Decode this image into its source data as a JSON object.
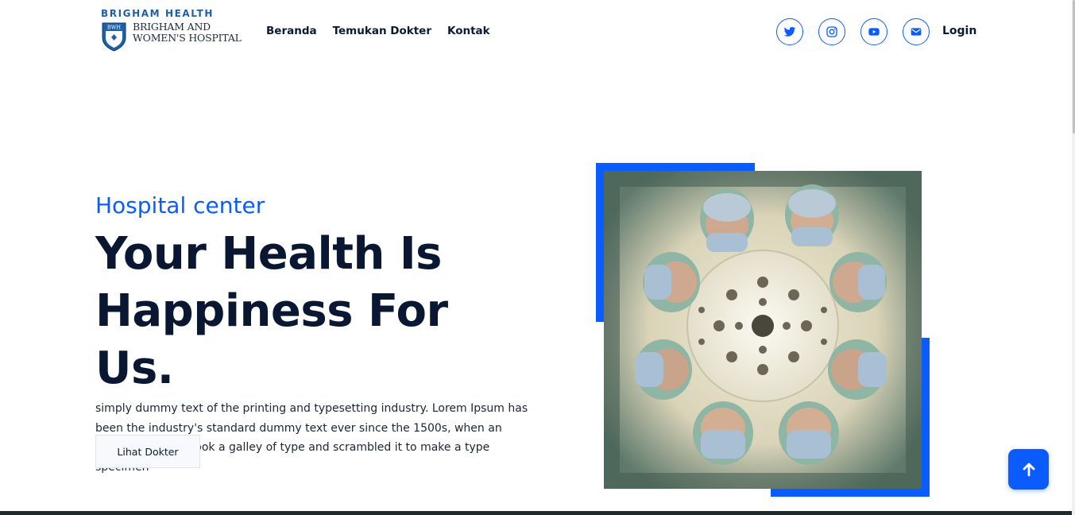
{
  "brand": {
    "top_text": "BRIGHAM HEALTH",
    "shield_text": "BWH",
    "name_line1": "BRIGHAM AND",
    "name_line2": "WOMEN'S HOSPITAL"
  },
  "nav": {
    "items": [
      {
        "label": "Beranda"
      },
      {
        "label": "Temukan Dokter"
      },
      {
        "label": "Kontak"
      }
    ],
    "socials": [
      {
        "icon": "twitter-icon"
      },
      {
        "icon": "instagram-icon"
      },
      {
        "icon": "youtube-icon"
      },
      {
        "icon": "envelope-icon"
      }
    ],
    "login_label": "Login"
  },
  "hero": {
    "subtitle": "Hospital center",
    "title_line1": "Your Health Is",
    "title_line2": "Happiness For Us.",
    "description": "simply dummy text of the printing and typesetting industry. Lorem Ipsum has been the industry's standard dummy text ever since the 1500s, when an unknown printer took a galley of type and scrambled it to make a type specimen",
    "cta_label": "Lihat Dokter",
    "image_alt": "surgeons looking down at camera under operating lamp"
  },
  "colors": {
    "accent": "#0b5cff",
    "heading": "#0a1733",
    "brand_blue": "#1f5fa6"
  },
  "scroll_top_icon": "arrow-up-icon"
}
